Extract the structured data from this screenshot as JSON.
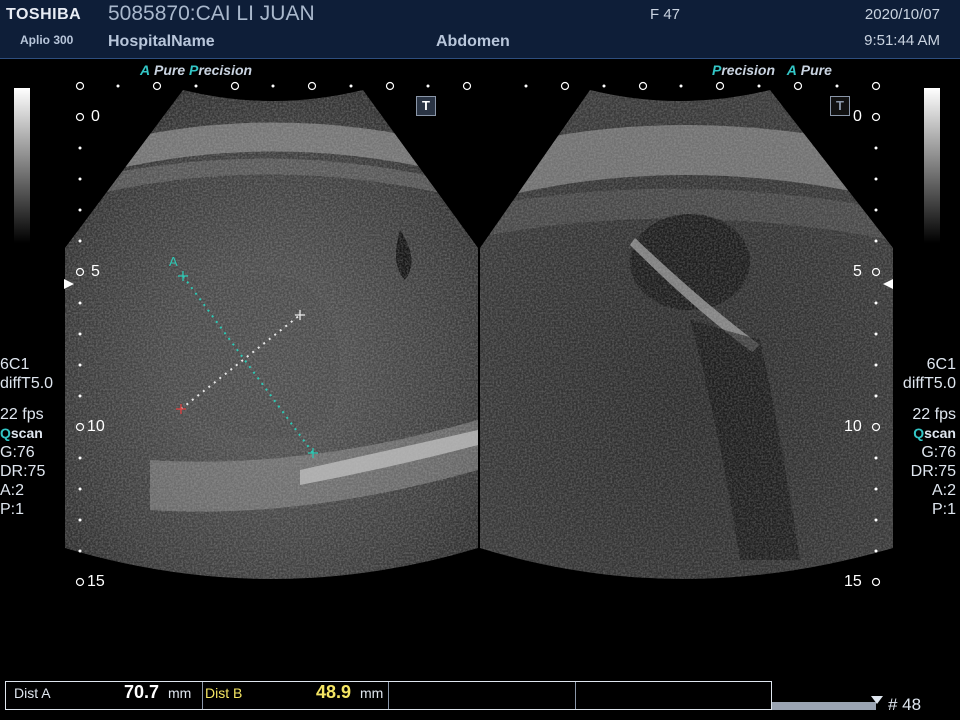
{
  "header": {
    "logo": "TOSHIBA",
    "model": "Aplio 300",
    "patient": "5085870:CAI LI JUAN",
    "hospital": "HospitalName",
    "sex_age": "F  47",
    "exam": "Abdomen",
    "date": "2020/10/07",
    "time": "9:51:44 AM"
  },
  "brand_left": {
    "a": "A",
    "pure": "Pure",
    "p": "P",
    "recision": "recision"
  },
  "brand_right": {
    "p": "P",
    "recision": "recision",
    "a": "A",
    "pure": "Pure"
  },
  "tbox": "T",
  "depth_marks": [
    "0",
    "5",
    "10",
    "15"
  ],
  "left_params": {
    "probe": "6C1",
    "mode": "diffT5.0",
    "fps": "22 fps",
    "q": "Q",
    "scan": "scan",
    "gain": "G:76",
    "dr": "DR:75",
    "a": "A:2",
    "p": "P:1"
  },
  "right_params": {
    "probe": "6C1",
    "mode": "diffT5.0",
    "fps": "22 fps",
    "q": "Q",
    "scan": "scan",
    "gain": "G:76",
    "dr": "DR:75",
    "a": "A:2",
    "p": "P:1"
  },
  "caliper_label": "A",
  "measurements": {
    "dist_a_label": "Dist A",
    "dist_a_value": "70.7",
    "dist_a_unit": "mm",
    "dist_b_label": "Dist B",
    "dist_b_value": "48.9",
    "dist_b_unit": "mm"
  },
  "frame": "# 48",
  "colors": {
    "header_bg": "#0e1e38",
    "cyan": "#33c6c6",
    "dist_b": "#f5e663",
    "caliper_a": "#2ec8b4",
    "caliper_b": "#e8e8e8",
    "marker_b_red": "#e04040"
  }
}
